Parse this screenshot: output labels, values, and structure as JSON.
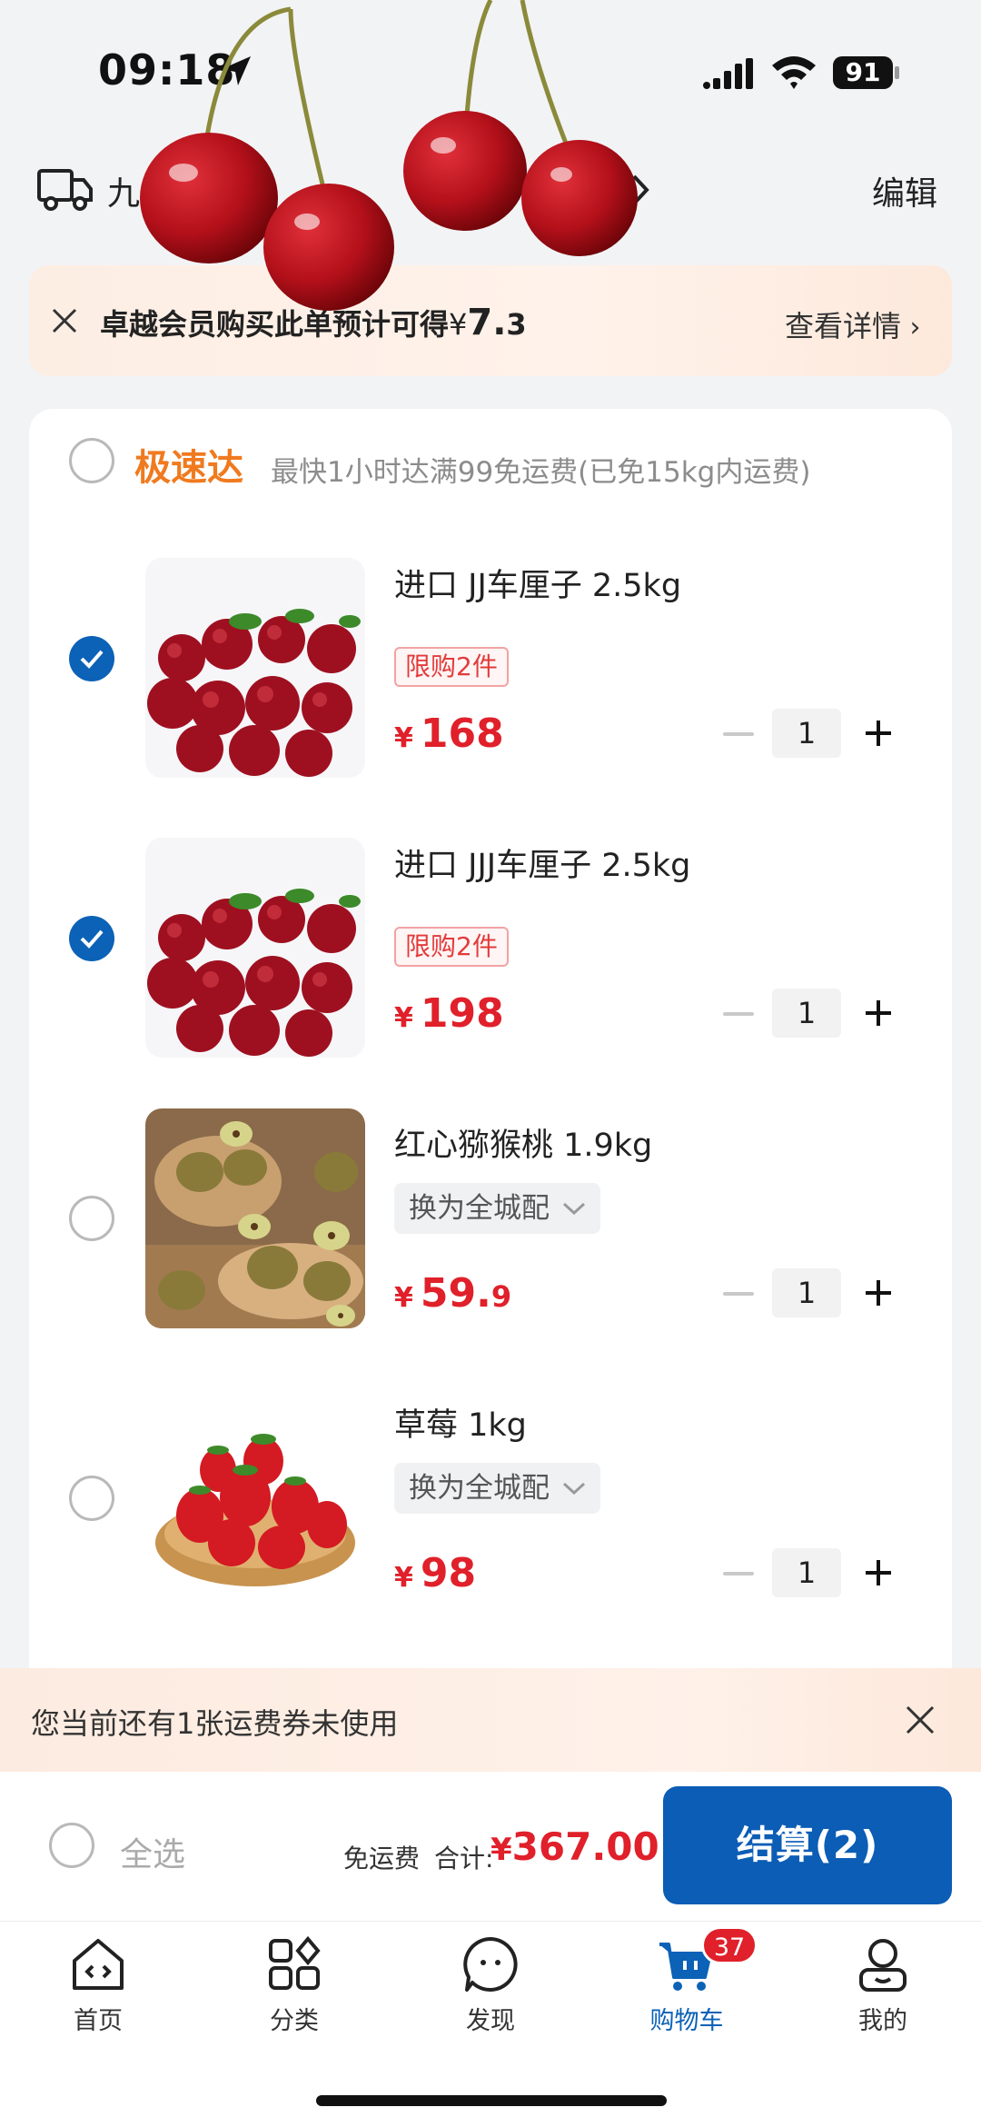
{
  "status_bar": {
    "time": "09:18",
    "battery": "91"
  },
  "header": {
    "address": "九        路126号",
    "edit_label": "编辑"
  },
  "member_banner": {
    "text": "卓越会员购买此单预计可得",
    "currency": "¥",
    "amount": "7.",
    "amount_small": "3",
    "link": "查看详情"
  },
  "section": {
    "title": "极速达",
    "note": "最快1小时达满99免运费(已免15kg内运费)"
  },
  "items": [
    {
      "name": "进口 JJ车厘子 2.5kg",
      "tag": "限购2件",
      "currency": "¥",
      "price": "168",
      "price_dec": "",
      "qty": "1",
      "selected": true
    },
    {
      "name": "进口 JJJ车厘子 2.5kg",
      "tag": "限购2件",
      "currency": "¥",
      "price": "198",
      "price_dec": "",
      "qty": "1",
      "selected": true
    },
    {
      "name": "红心猕猴桃 1.9kg",
      "switch_label": "换为全城配",
      "currency": "¥",
      "price": "59.",
      "price_dec": "9",
      "qty": "1",
      "selected": false
    },
    {
      "name": "草莓 1kg",
      "switch_label": "换为全城配",
      "currency": "¥",
      "price": "98",
      "price_dec": "",
      "qty": "1",
      "selected": false
    }
  ],
  "coupon_bar": {
    "text": "您当前还有1张运费券未使用"
  },
  "checkout": {
    "select_all": "全选",
    "free_shipping": "免运费",
    "total_label": "合计:",
    "currency": "¥",
    "total": "367.00",
    "pay_button": "结算(2)"
  },
  "tabbar": {
    "tabs": [
      {
        "label": "首页",
        "icon": "home-icon"
      },
      {
        "label": "分类",
        "icon": "category-icon"
      },
      {
        "label": "发现",
        "icon": "discover-icon"
      },
      {
        "label": "购物车",
        "icon": "cart-icon"
      },
      {
        "label": "我的",
        "icon": "profile-icon"
      }
    ],
    "cart_badge": "37"
  },
  "colors": {
    "accent": "#0b62b6",
    "price": "#e0202a",
    "express": "#f07a1f"
  }
}
